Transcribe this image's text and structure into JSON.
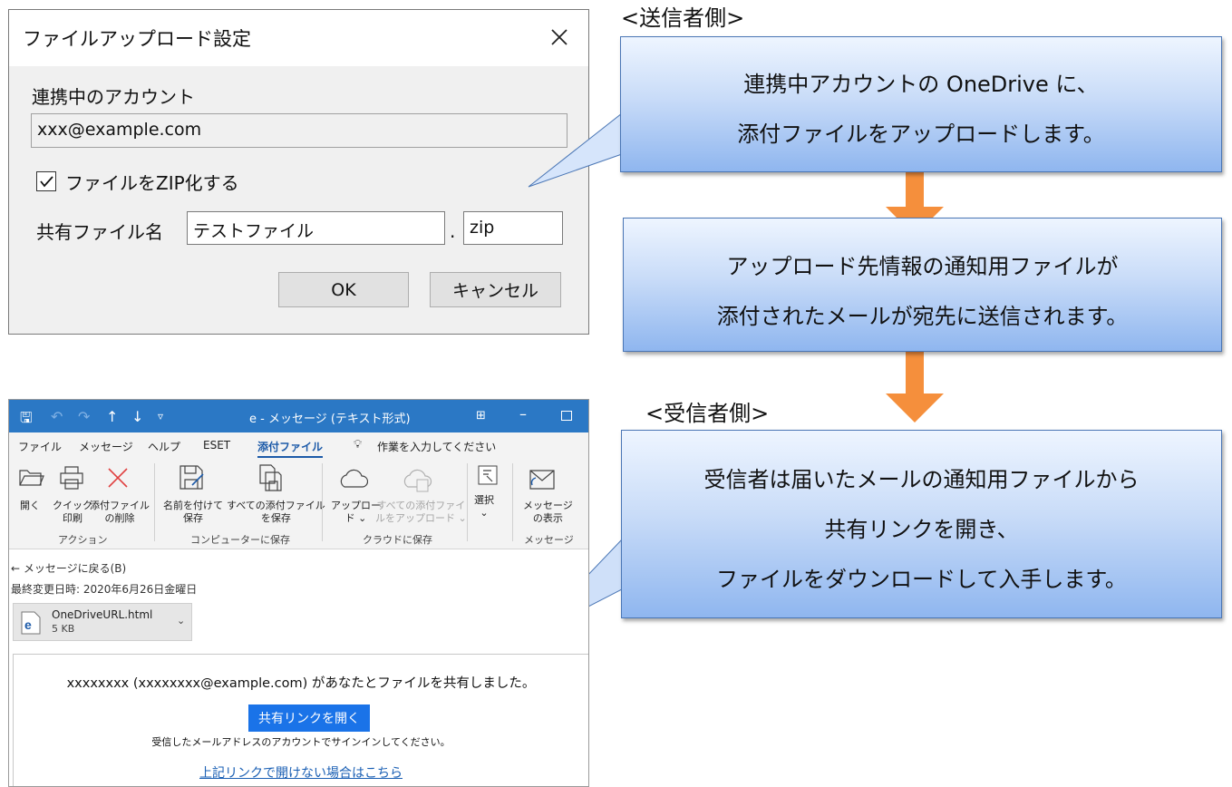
{
  "dialog": {
    "title": "ファイルアップロード設定",
    "account_label": "連携中のアカウント",
    "account_value": "xxx@example.com",
    "zip_label": "ファイルをZIP化する",
    "zip_checked": true,
    "share_name_label": "共有ファイル名",
    "share_name_value": "テストファイル",
    "dot": ".",
    "extension_value": "zip",
    "ok_label": "OK",
    "cancel_label": "キャンセル"
  },
  "sender_heading": "<送信者側>",
  "receiver_heading": "<受信者側>",
  "callouts": {
    "sender": [
      "連携中アカウントの OneDrive に、",
      "添付ファイルをアップロードします。"
    ],
    "middle": [
      "アップロード先情報の通知用ファイルが",
      "添付されたメールが宛先に送信されます。"
    ],
    "receiver": [
      "受信者は届いたメールの通知用ファイルから",
      "共有リンクを開き、",
      "ファイルをダウンロードして入手します。"
    ]
  },
  "outlook": {
    "window_title": "e  -  メッセージ (テキスト形式)",
    "menu": [
      "ファイル",
      "メッセージ",
      "ヘルプ",
      "ESET",
      "添付ファイル"
    ],
    "active_menu": "添付ファイル",
    "tell_me": "作業を入力してください",
    "ribbon": {
      "open": "開く",
      "quick_print": [
        "クイック",
        "印刷"
      ],
      "remove_attachment": [
        "添付ファイル",
        "の削除"
      ],
      "save_as": [
        "名前を付けて",
        "保存"
      ],
      "save_all": [
        "すべての添付ファイル",
        "を保存"
      ],
      "upload": [
        "アップロー",
        "ド ⌄"
      ],
      "upload_all": [
        "すべての添付ファイ",
        "ルをアップロード ⌄"
      ],
      "select": [
        "選択",
        "⌄"
      ],
      "show_message": [
        "メッセージ",
        "の表示"
      ],
      "groups": [
        "アクション",
        "コンピューターに保存",
        "クラウドに保存",
        "メッセージ"
      ]
    },
    "back_link": "← メッセージに戻る(B)",
    "modified": "最終変更日時:   2020年6月26日金曜日",
    "attachment_name": "OneDriveURL.html",
    "attachment_size": "5 KB",
    "shared_text": "xxxxxxxx (xxxxxxxx@example.com) があなたとファイルを共有しました。",
    "share_button": "共有リンクを開く",
    "signin_text": "受信したメールアドレスのアカウントでサインインしてください。",
    "fallback_link": "上記リンクで開けない場合はこちら"
  },
  "colors": {
    "arrow": "#f58f3c",
    "outlook_titlebar": "#2b78c5",
    "callout_border": "#4a76b5",
    "share_button": "#1a73e8"
  }
}
